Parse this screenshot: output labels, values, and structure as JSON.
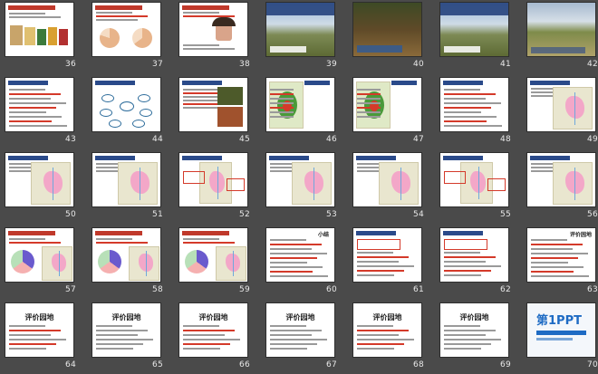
{
  "slides": [
    {
      "num": "36"
    },
    {
      "num": "37"
    },
    {
      "num": "38"
    },
    {
      "num": "39"
    },
    {
      "num": "40"
    },
    {
      "num": "41"
    },
    {
      "num": "42"
    },
    {
      "num": "43"
    },
    {
      "num": "44"
    },
    {
      "num": "45"
    },
    {
      "num": "46"
    },
    {
      "num": "47"
    },
    {
      "num": "48"
    },
    {
      "num": "49"
    },
    {
      "num": "50"
    },
    {
      "num": "51"
    },
    {
      "num": "52"
    },
    {
      "num": "53"
    },
    {
      "num": "54"
    },
    {
      "num": "55"
    },
    {
      "num": "56"
    },
    {
      "num": "57"
    },
    {
      "num": "58"
    },
    {
      "num": "59"
    },
    {
      "num": "60"
    },
    {
      "num": "61"
    },
    {
      "num": "62"
    },
    {
      "num": "63"
    },
    {
      "num": "64"
    },
    {
      "num": "65"
    },
    {
      "num": "66"
    },
    {
      "num": "67"
    },
    {
      "num": "68"
    },
    {
      "num": "69"
    },
    {
      "num": "70"
    }
  ],
  "texts": {
    "s39_title": "二、从“北大荒”到“北大仓”",
    "s41_title": "二、从“北大荒”到“北大仓”",
    "s60_title": "小结",
    "s63_title": "评价园地",
    "s64_title": "评价园地",
    "s65_title": "评价园地",
    "s66_title": "评价园地",
    "s67_title": "评价园地",
    "s68_title": "评价园地",
    "s69_title": "评价园地",
    "s70_brand": "第1PPT"
  }
}
